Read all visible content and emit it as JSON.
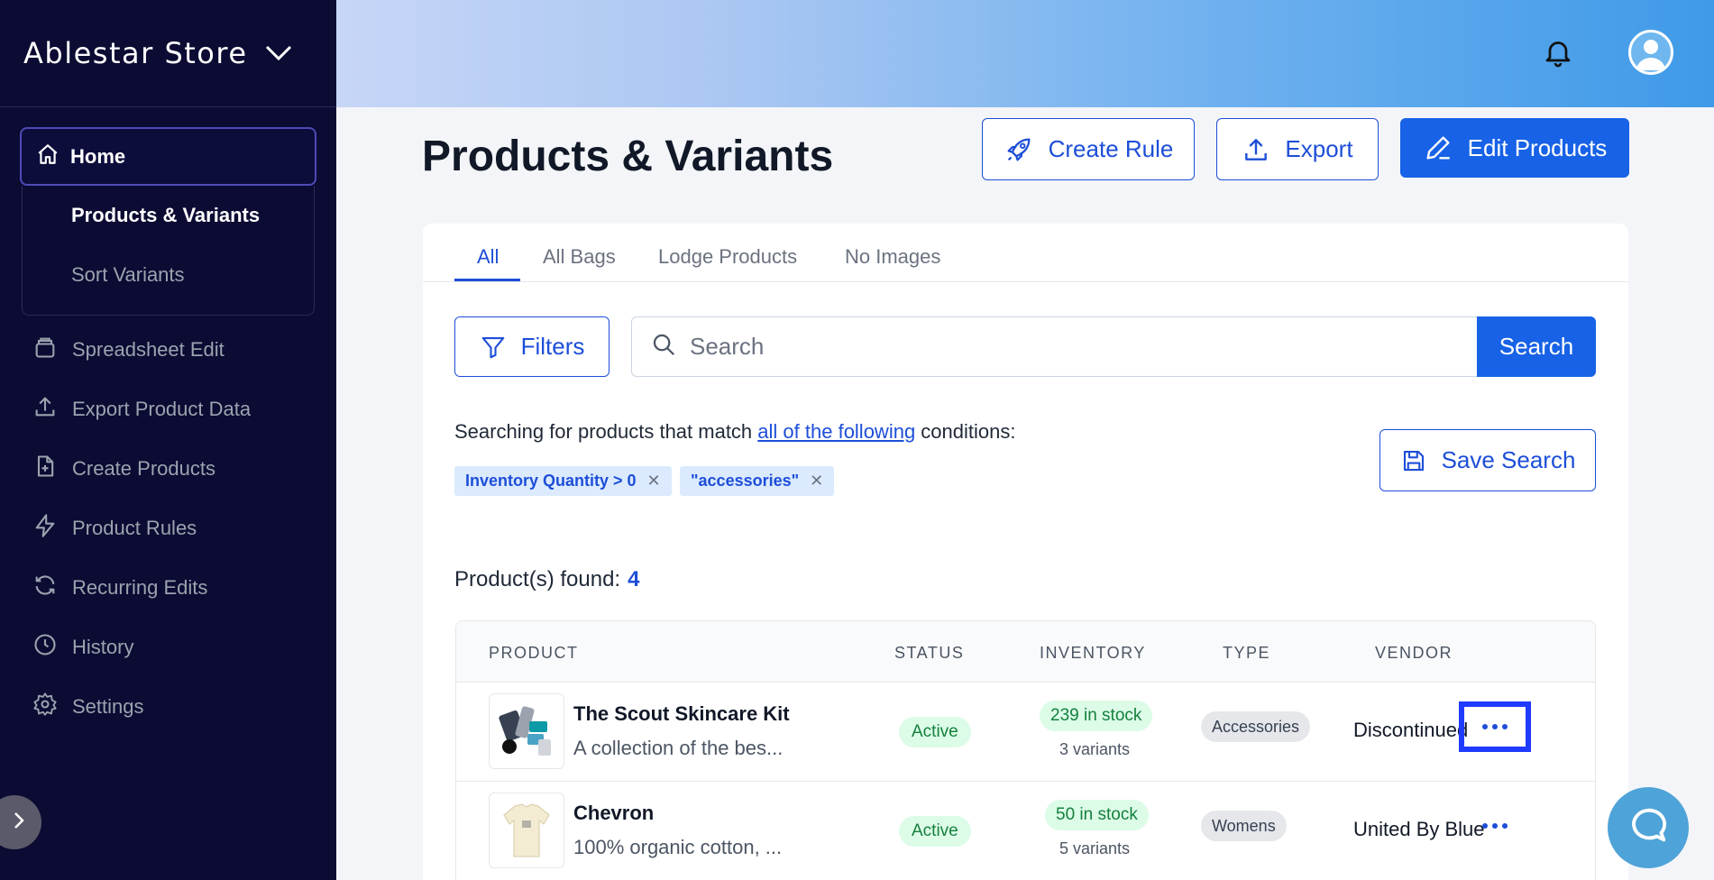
{
  "sidebar": {
    "store_name": "Ablestar Store",
    "home_label": "Home",
    "subnav": [
      "Products & Variants",
      "Sort Variants"
    ],
    "items": [
      {
        "label": "Spreadsheet Edit",
        "icon": "layers-icon"
      },
      {
        "label": "Export Product Data",
        "icon": "upload-icon"
      },
      {
        "label": "Create Products",
        "icon": "file-plus-icon"
      },
      {
        "label": "Product Rules",
        "icon": "lightning-icon"
      },
      {
        "label": "Recurring Edits",
        "icon": "refresh-icon"
      },
      {
        "label": "History",
        "icon": "clock-icon"
      },
      {
        "label": "Settings",
        "icon": "gear-icon"
      }
    ]
  },
  "header": {
    "page_title": "Products & Variants",
    "create_rule_label": "Create Rule",
    "export_label": "Export",
    "edit_products_label": "Edit Products"
  },
  "tabs": [
    "All",
    "All Bags",
    "Lodge Products",
    "No Images"
  ],
  "filters_label": "Filters",
  "search": {
    "placeholder": "Search",
    "button_label": "Search"
  },
  "conditions": {
    "prefix": "Searching for products that match ",
    "link": "all of the following",
    "suffix": " conditions:",
    "chips": [
      "Inventory Quantity > 0",
      "\"accessories\""
    ]
  },
  "save_search_label": "Save Search",
  "results": {
    "label": "Product(s) found:",
    "count": "4"
  },
  "table": {
    "headers": [
      "PRODUCT",
      "STATUS",
      "INVENTORY",
      "TYPE",
      "VENDOR"
    ],
    "rows": [
      {
        "name": "The Scout Skincare Kit",
        "desc": "A collection of the bes...",
        "status": "Active",
        "stock": "239 in stock",
        "variants": "3 variants",
        "type": "Accessories",
        "vendor": "Discontinued"
      },
      {
        "name": "Chevron",
        "desc": "100% organic cotton, ...",
        "status": "Active",
        "stock": "50 in stock",
        "variants": "5 variants",
        "type": "Womens",
        "vendor": "United By Blue"
      }
    ]
  },
  "colors": {
    "sidebar_bg": "#0b0b33",
    "accent": "#1762e6",
    "status_green": "#15803d"
  }
}
